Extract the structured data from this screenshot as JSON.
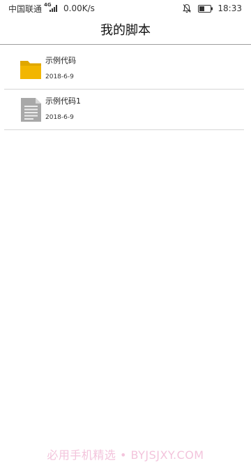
{
  "status_bar": {
    "carrier": "中国联通",
    "network": "4G",
    "speed": "0.00K/s",
    "time": "18:33",
    "icons": [
      "signal-icon",
      "mute-bell-icon",
      "battery-icon"
    ]
  },
  "header": {
    "title": "我的脚本"
  },
  "files": [
    {
      "name": "示例代码",
      "date": "2018-6-9",
      "icon": "folder-icon"
    },
    {
      "name": "示例代码1",
      "date": "2018-6-9",
      "icon": "document-icon"
    }
  ],
  "watermark": "必用手机精选 • BYJSJXY.COM",
  "colors": {
    "folder": "#f2b600",
    "document": "#a8a8a8",
    "watermark": "#f3c4dc"
  }
}
